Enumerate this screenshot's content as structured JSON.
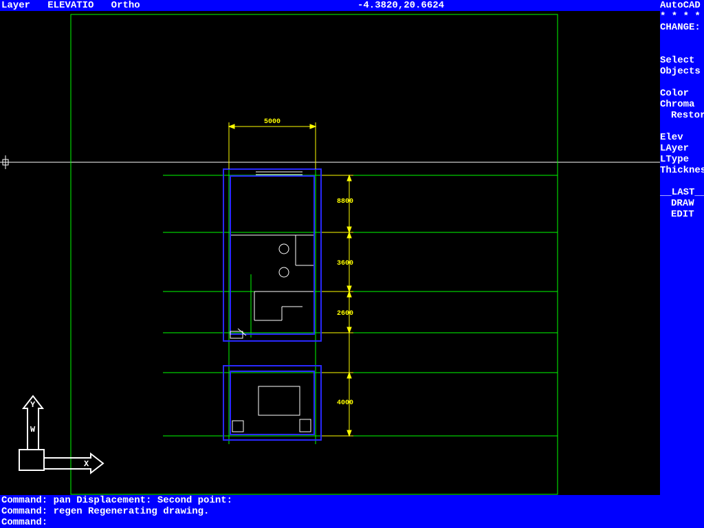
{
  "status": {
    "layer_label": "Layer",
    "layer_name": "ELEVATIO",
    "ortho": "Ortho",
    "coords": "-4.3820,20.6624"
  },
  "menu": {
    "title": "AutoCAD",
    "stars": "* * * *",
    "change": "CHANGE:",
    "select": "Select",
    "objects": "Objects",
    "color": "Color",
    "chroma": "Chroma",
    "restore": "Restore",
    "elev": "Elev",
    "layer": "LAyer",
    "ltype": "LType",
    "thicknes": "Thicknes",
    "last": "__LAST__",
    "draw": "DRAW",
    "edit": "EDIT"
  },
  "cmd": {
    "line1": "Command: pan Displacement:  Second point:",
    "line2": "Command: regen Regenerating drawing.",
    "line3": "Command:"
  },
  "dims": {
    "top": "5000",
    "r1": "8800",
    "r2": "3600",
    "r3": "2600",
    "r4": "4000"
  },
  "ucs": {
    "x": "X",
    "y": "Y",
    "w": "W"
  },
  "colors": {
    "bg": "#000000",
    "ui": "#0000ff",
    "text": "#ffffff",
    "limits": "#00ff00",
    "walls": "#0000ff",
    "interior": "#ffffff",
    "dims": "#ffff00"
  }
}
